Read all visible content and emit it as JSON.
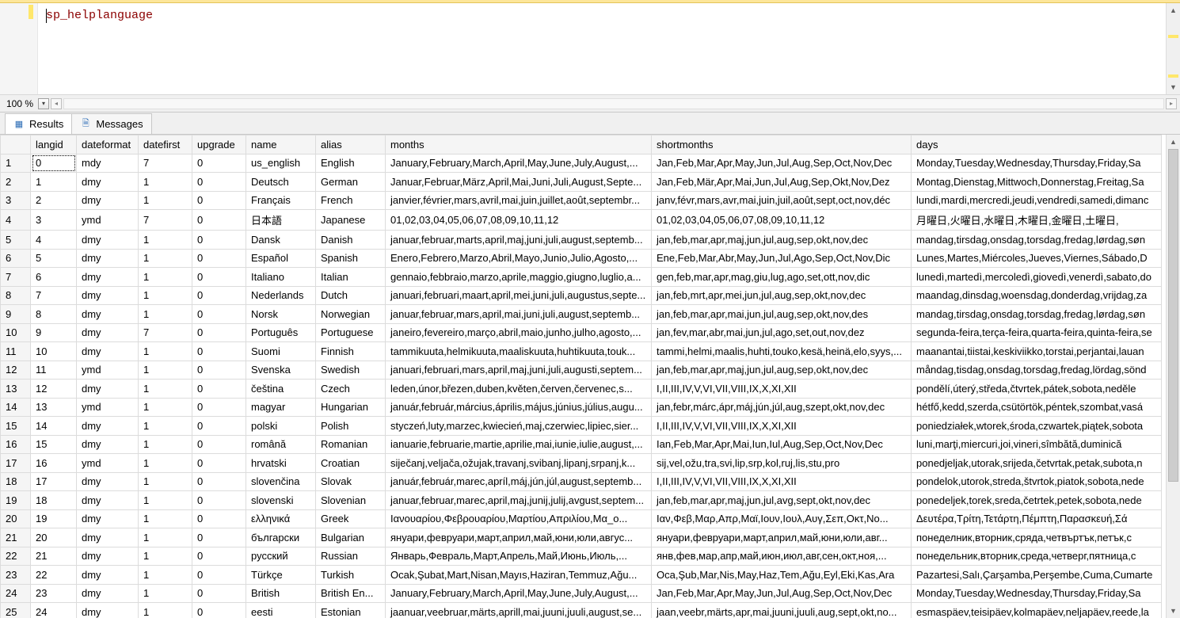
{
  "editor": {
    "query": "sp_helplanguage"
  },
  "zoom": {
    "level": "100 %"
  },
  "tabs": {
    "results": "Results",
    "messages": "Messages"
  },
  "grid": {
    "columns": [
      "langid",
      "dateformat",
      "datefirst",
      "upgrade",
      "name",
      "alias",
      "months",
      "shortmonths",
      "days"
    ],
    "rows": [
      {
        "n": "1",
        "langid": "0",
        "dateformat": "mdy",
        "datefirst": "7",
        "upgrade": "0",
        "name": "us_english",
        "alias": "English",
        "months": "January,February,March,April,May,June,July,August,...",
        "shortmonths": "Jan,Feb,Mar,Apr,May,Jun,Jul,Aug,Sep,Oct,Nov,Dec",
        "days": "Monday,Tuesday,Wednesday,Thursday,Friday,Sa"
      },
      {
        "n": "2",
        "langid": "1",
        "dateformat": "dmy",
        "datefirst": "1",
        "upgrade": "0",
        "name": "Deutsch",
        "alias": "German",
        "months": "Januar,Februar,März,April,Mai,Juni,Juli,August,Septe...",
        "shortmonths": "Jan,Feb,Mär,Apr,Mai,Jun,Jul,Aug,Sep,Okt,Nov,Dez",
        "days": "Montag,Dienstag,Mittwoch,Donnerstag,Freitag,Sa"
      },
      {
        "n": "3",
        "langid": "2",
        "dateformat": "dmy",
        "datefirst": "1",
        "upgrade": "0",
        "name": "Français",
        "alias": "French",
        "months": "janvier,février,mars,avril,mai,juin,juillet,août,septembr...",
        "shortmonths": "janv,févr,mars,avr,mai,juin,juil,août,sept,oct,nov,déc",
        "days": "lundi,mardi,mercredi,jeudi,vendredi,samedi,dimanc"
      },
      {
        "n": "4",
        "langid": "3",
        "dateformat": "ymd",
        "datefirst": "7",
        "upgrade": "0",
        "name": "日本語",
        "alias": "Japanese",
        "months": "01,02,03,04,05,06,07,08,09,10,11,12",
        "shortmonths": "01,02,03,04,05,06,07,08,09,10,11,12",
        "days": "月曜日,火曜日,水曜日,木曜日,金曜日,土曜日,"
      },
      {
        "n": "5",
        "langid": "4",
        "dateformat": "dmy",
        "datefirst": "1",
        "upgrade": "0",
        "name": "Dansk",
        "alias": "Danish",
        "months": "januar,februar,marts,april,maj,juni,juli,august,septemb...",
        "shortmonths": "jan,feb,mar,apr,maj,jun,jul,aug,sep,okt,nov,dec",
        "days": "mandag,tirsdag,onsdag,torsdag,fredag,lørdag,søn"
      },
      {
        "n": "6",
        "langid": "5",
        "dateformat": "dmy",
        "datefirst": "1",
        "upgrade": "0",
        "name": "Español",
        "alias": "Spanish",
        "months": "Enero,Febrero,Marzo,Abril,Mayo,Junio,Julio,Agosto,...",
        "shortmonths": "Ene,Feb,Mar,Abr,May,Jun,Jul,Ago,Sep,Oct,Nov,Dic",
        "days": "Lunes,Martes,Miércoles,Jueves,Viernes,Sábado,D"
      },
      {
        "n": "7",
        "langid": "6",
        "dateformat": "dmy",
        "datefirst": "1",
        "upgrade": "0",
        "name": "Italiano",
        "alias": "Italian",
        "months": "gennaio,febbraio,marzo,aprile,maggio,giugno,luglio,a...",
        "shortmonths": "gen,feb,mar,apr,mag,giu,lug,ago,set,ott,nov,dic",
        "days": "lunedì,martedì,mercoledì,giovedì,venerdì,sabato,do"
      },
      {
        "n": "8",
        "langid": "7",
        "dateformat": "dmy",
        "datefirst": "1",
        "upgrade": "0",
        "name": "Nederlands",
        "alias": "Dutch",
        "months": "januari,februari,maart,april,mei,juni,juli,augustus,septe...",
        "shortmonths": "jan,feb,mrt,apr,mei,jun,jul,aug,sep,okt,nov,dec",
        "days": "maandag,dinsdag,woensdag,donderdag,vrijdag,za"
      },
      {
        "n": "9",
        "langid": "8",
        "dateformat": "dmy",
        "datefirst": "1",
        "upgrade": "0",
        "name": "Norsk",
        "alias": "Norwegian",
        "months": "januar,februar,mars,april,mai,juni,juli,august,septemb...",
        "shortmonths": "jan,feb,mar,apr,mai,jun,jul,aug,sep,okt,nov,des",
        "days": "mandag,tirsdag,onsdag,torsdag,fredag,lørdag,søn"
      },
      {
        "n": "10",
        "langid": "9",
        "dateformat": "dmy",
        "datefirst": "7",
        "upgrade": "0",
        "name": "Português",
        "alias": "Portuguese",
        "months": "janeiro,fevereiro,março,abril,maio,junho,julho,agosto,...",
        "shortmonths": "jan,fev,mar,abr,mai,jun,jul,ago,set,out,nov,dez",
        "days": "segunda-feira,terça-feira,quarta-feira,quinta-feira,se"
      },
      {
        "n": "11",
        "langid": "10",
        "dateformat": "dmy",
        "datefirst": "1",
        "upgrade": "0",
        "name": "Suomi",
        "alias": "Finnish",
        "months": "tammikuuta,helmikuuta,maaliskuuta,huhtikuuta,touk...",
        "shortmonths": "tammi,helmi,maalis,huhti,touko,kesä,heinä,elo,syys,...",
        "days": "maanantai,tiistai,keskiviikko,torstai,perjantai,lauan"
      },
      {
        "n": "12",
        "langid": "11",
        "dateformat": "ymd",
        "datefirst": "1",
        "upgrade": "0",
        "name": "Svenska",
        "alias": "Swedish",
        "months": "januari,februari,mars,april,maj,juni,juli,augusti,septem...",
        "shortmonths": "jan,feb,mar,apr,maj,jun,jul,aug,sep,okt,nov,dec",
        "days": "måndag,tisdag,onsdag,torsdag,fredag,lördag,sönd"
      },
      {
        "n": "13",
        "langid": "12",
        "dateformat": "dmy",
        "datefirst": "1",
        "upgrade": "0",
        "name": "čeština",
        "alias": "Czech",
        "months": "leden,únor,březen,duben,květen,červen,červenec,s...",
        "shortmonths": "I,II,III,IV,V,VI,VII,VIII,IX,X,XI,XII",
        "days": "pondělí,úterý,středa,čtvrtek,pátek,sobota,neděle"
      },
      {
        "n": "14",
        "langid": "13",
        "dateformat": "ymd",
        "datefirst": "1",
        "upgrade": "0",
        "name": "magyar",
        "alias": "Hungarian",
        "months": "január,február,március,április,május,június,július,augu...",
        "shortmonths": "jan,febr,márc,ápr,máj,jún,júl,aug,szept,okt,nov,dec",
        "days": "hétfő,kedd,szerda,csütörtök,péntek,szombat,vasá"
      },
      {
        "n": "15",
        "langid": "14",
        "dateformat": "dmy",
        "datefirst": "1",
        "upgrade": "0",
        "name": "polski",
        "alias": "Polish",
        "months": "styczeń,luty,marzec,kwiecień,maj,czerwiec,lipiec,sier...",
        "shortmonths": "I,II,III,IV,V,VI,VII,VIII,IX,X,XI,XII",
        "days": "poniedziałek,wtorek,środa,czwartek,piątek,sobota"
      },
      {
        "n": "16",
        "langid": "15",
        "dateformat": "dmy",
        "datefirst": "1",
        "upgrade": "0",
        "name": "română",
        "alias": "Romanian",
        "months": "ianuarie,februarie,martie,aprilie,mai,iunie,iulie,august,...",
        "shortmonths": "Ian,Feb,Mar,Apr,Mai,Iun,Iul,Aug,Sep,Oct,Nov,Dec",
        "days": "luni,marţi,miercuri,joi,vineri,sîmbătă,duminică"
      },
      {
        "n": "17",
        "langid": "16",
        "dateformat": "ymd",
        "datefirst": "1",
        "upgrade": "0",
        "name": "hrvatski",
        "alias": "Croatian",
        "months": "siječanj,veljača,ožujak,travanj,svibanj,lipanj,srpanj,k...",
        "shortmonths": "sij,vel,ožu,tra,svi,lip,srp,kol,ruj,lis,stu,pro",
        "days": "ponedjeljak,utorak,srijeda,četvrtak,petak,subota,n"
      },
      {
        "n": "18",
        "langid": "17",
        "dateformat": "dmy",
        "datefirst": "1",
        "upgrade": "0",
        "name": "slovenčina",
        "alias": "Slovak",
        "months": "január,február,marec,apríl,máj,jún,júl,august,septemb...",
        "shortmonths": "I,II,III,IV,V,VI,VII,VIII,IX,X,XI,XII",
        "days": "pondelok,utorok,streda,štvrtok,piatok,sobota,nede"
      },
      {
        "n": "19",
        "langid": "18",
        "dateformat": "dmy",
        "datefirst": "1",
        "upgrade": "0",
        "name": "slovenski",
        "alias": "Slovenian",
        "months": "januar,februar,marec,april,maj,junij,julij,avgust,septem...",
        "shortmonths": "jan,feb,mar,apr,maj,jun,jul,avg,sept,okt,nov,dec",
        "days": "ponedeljek,torek,sreda,četrtek,petek,sobota,nede"
      },
      {
        "n": "20",
        "langid": "19",
        "dateformat": "dmy",
        "datefirst": "1",
        "upgrade": "0",
        "name": "ελληνικά",
        "alias": "Greek",
        "months": "Ιανουαρίου,Φεβρουαρίου,Μαρτίου,Απριλίου,Μα_ο...",
        "shortmonths": "Ιαν,Φεβ,Μαρ,Απρ,Μαϊ,Ιουν,Ιουλ,Αυγ,Σεπ,Οκτ,Νο...",
        "days": "Δευτέρα,Τρίτη,Τετάρτη,Πέμπτη,Παρασκευή,Σά"
      },
      {
        "n": "21",
        "langid": "20",
        "dateformat": "dmy",
        "datefirst": "1",
        "upgrade": "0",
        "name": "български",
        "alias": "Bulgarian",
        "months": "януари,февруари,март,април,май,юни,юли,авгус...",
        "shortmonths": "януари,февруари,март,април,май,юни,юли,авг...",
        "days": "понеделник,вторник,сряда,четвъртък,петък,с"
      },
      {
        "n": "22",
        "langid": "21",
        "dateformat": "dmy",
        "datefirst": "1",
        "upgrade": "0",
        "name": "русский",
        "alias": "Russian",
        "months": "Январь,Февраль,Март,Апрель,Май,Июнь,Июль,...",
        "shortmonths": "янв,фев,мар,апр,май,июн,июл,авг,сен,окт,ноя,...",
        "days": "понедельник,вторник,среда,четверг,пятница,с"
      },
      {
        "n": "23",
        "langid": "22",
        "dateformat": "dmy",
        "datefirst": "1",
        "upgrade": "0",
        "name": "Türkçe",
        "alias": "Turkish",
        "months": "Ocak,Şubat,Mart,Nisan,Mayıs,Haziran,Temmuz,Ağu...",
        "shortmonths": "Oca,Şub,Mar,Nis,May,Haz,Tem,Ağu,Eyl,Eki,Kas,Ara",
        "days": "Pazartesi,Salı,Çarşamba,Perşembe,Cuma,Cumarte"
      },
      {
        "n": "24",
        "langid": "23",
        "dateformat": "dmy",
        "datefirst": "1",
        "upgrade": "0",
        "name": "British",
        "alias": "British En...",
        "months": "January,February,March,April,May,June,July,August,...",
        "shortmonths": "Jan,Feb,Mar,Apr,May,Jun,Jul,Aug,Sep,Oct,Nov,Dec",
        "days": "Monday,Tuesday,Wednesday,Thursday,Friday,Sa"
      },
      {
        "n": "25",
        "langid": "24",
        "dateformat": "dmy",
        "datefirst": "1",
        "upgrade": "0",
        "name": "eesti",
        "alias": "Estonian",
        "months": "jaanuar,veebruar,märts,aprill,mai,juuni,juuli,august,se...",
        "shortmonths": "jaan,veebr,märts,apr,mai,juuni,juuli,aug,sept,okt,no...",
        "days": "esmaspäev,teisipäev,kolmapäev,neljapäev,reede,la"
      }
    ]
  }
}
